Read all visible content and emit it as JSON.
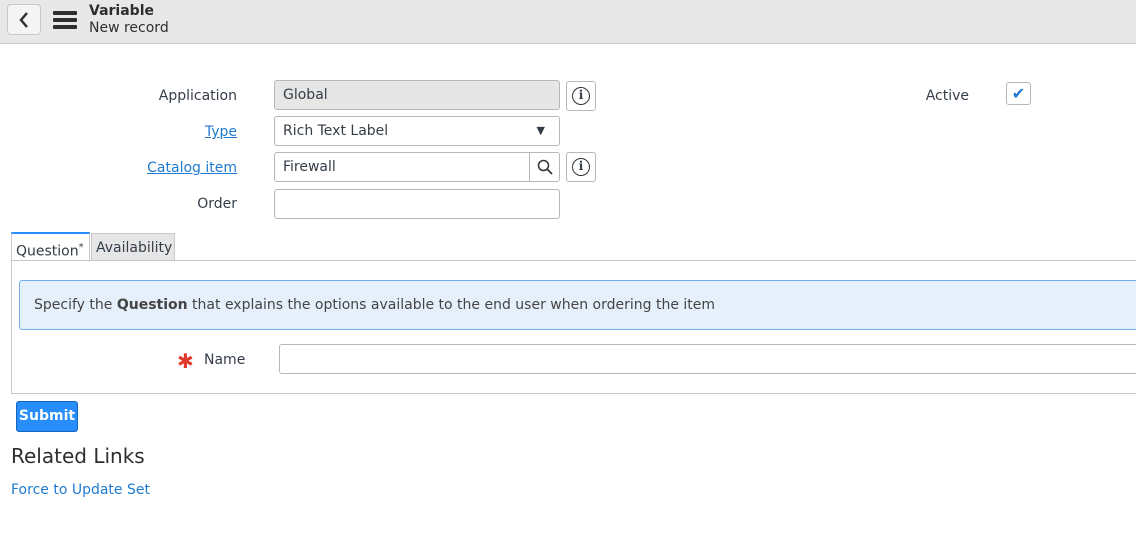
{
  "header": {
    "title": "Variable",
    "subtitle": "New record"
  },
  "form": {
    "application": {
      "label": "Application",
      "value": "Global"
    },
    "type": {
      "label": "Type",
      "value": "Rich Text Label"
    },
    "catalog_item": {
      "label": "Catalog item",
      "value": "Firewall"
    },
    "order": {
      "label": "Order",
      "value": ""
    },
    "active": {
      "label": "Active",
      "checked": true
    }
  },
  "tabs": [
    {
      "label": "Question",
      "required": "*",
      "active": true
    },
    {
      "label": "Availability",
      "active": false
    }
  ],
  "question": {
    "info_prefix": "Specify the ",
    "info_bold": "Question",
    "info_suffix": " that explains the options available to the end user when ordering the item",
    "name_label": "Name",
    "name_value": "",
    "required_mark": "✱"
  },
  "submit_label": "Submit",
  "related": {
    "title": "Related Links",
    "links": [
      "Force to Update Set"
    ]
  },
  "colors": {
    "accent": "#278efc",
    "link": "#1f7ad1",
    "required": "#e0392b"
  }
}
